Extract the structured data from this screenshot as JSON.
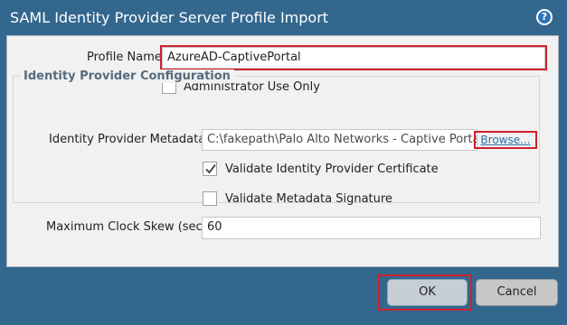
{
  "dialog": {
    "title": "SAML Identity Provider Server Profile Import",
    "help_icon": "help-icon"
  },
  "form": {
    "profile_name_label": "Profile Name",
    "profile_name_value": "AzureAD-CaptivePortal",
    "admin_use_only_label": "Administrator Use Only",
    "admin_use_only_checked": false
  },
  "idp_config": {
    "legend": "Identity Provider Configuration",
    "metadata_label": "Identity Provider Metadata",
    "metadata_value": "C:\\fakepath\\Palo Alto Networks - Captive Portal.xml",
    "browse_label": "Browse...",
    "validate_cert_label": "Validate Identity Provider Certificate",
    "validate_cert_checked": true,
    "validate_sig_label": "Validate Metadata Signature",
    "validate_sig_checked": false
  },
  "clock_skew": {
    "label": "Maximum Clock Skew (sec)",
    "value": "60"
  },
  "buttons": {
    "ok": "OK",
    "cancel": "Cancel"
  },
  "colors": {
    "background": "#33678e",
    "highlight": "#d0202b",
    "link": "#2e6fa7"
  }
}
